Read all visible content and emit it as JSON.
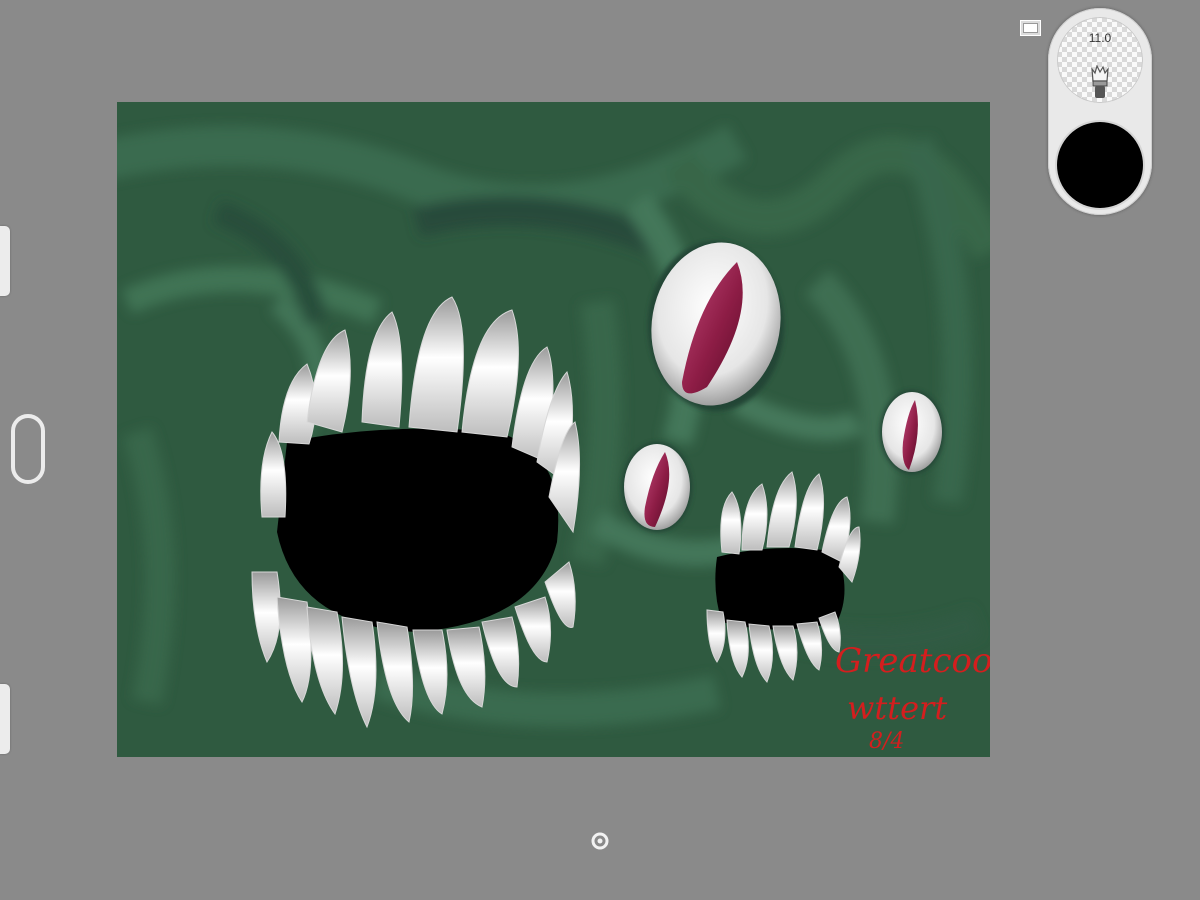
{
  "toolbar": {
    "brush_size": "11.0",
    "brush_icon": "brush-icon",
    "color": "#000000",
    "layers_icon": "layers-icon"
  },
  "canvas": {
    "signature_line1": "Greatcoo",
    "signature_line2": "wttert",
    "signature_date": "8/4",
    "background_color": "#2f5a40",
    "accent_color": "#a0214a"
  },
  "controls": {
    "left_sliders": [
      "brush-size-slider",
      "opacity-slider"
    ],
    "center_icon": "eyedropper-toggle-icon",
    "bottom_icon": "settings-ring-icon"
  }
}
